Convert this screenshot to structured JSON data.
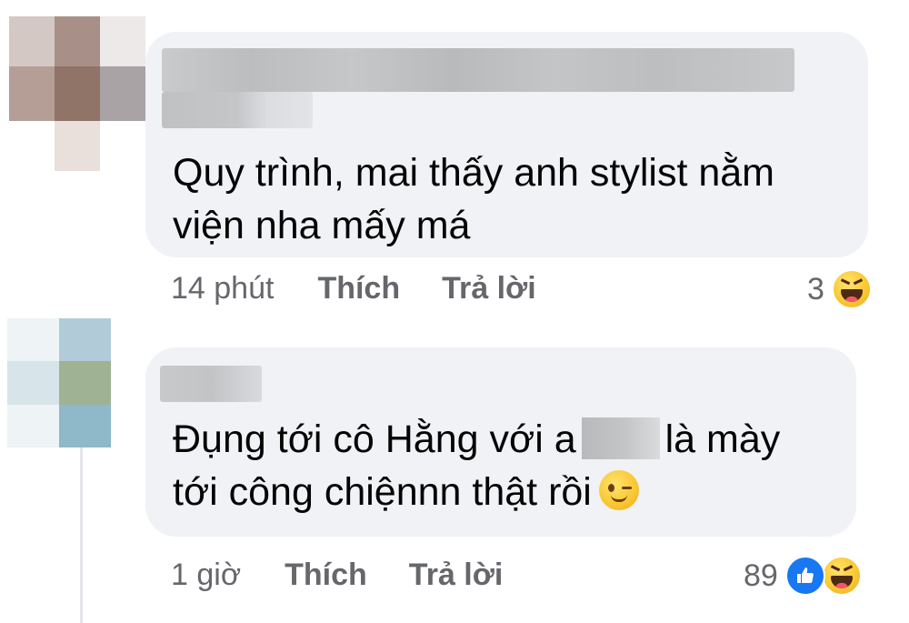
{
  "comments": [
    {
      "text_lines": [
        "Quy trình, mai thấy anh stylist nằm",
        "viện nha mấy má"
      ],
      "time": "14 phút",
      "like_label": "Thích",
      "reply_label": "Trả lời",
      "reaction_count": "3",
      "reactions": [
        "haha-icon"
      ]
    },
    {
      "text_line1_before": "Đụng tới cô Hằng với a",
      "text_line1_after": "là mày",
      "text_line2": "tới công chiệnnn thật rồi",
      "inline_emoji": "wink-emoji-icon",
      "time": "1 giờ",
      "like_label": "Thích",
      "reply_label": "Trả lời",
      "reaction_count": "89",
      "reactions": [
        "like-icon",
        "haha-icon"
      ]
    }
  ],
  "colors": {
    "bubble": "#f0f2f5",
    "text": "#050505",
    "meta": "#65676b",
    "like_blue": "#1877f2"
  }
}
